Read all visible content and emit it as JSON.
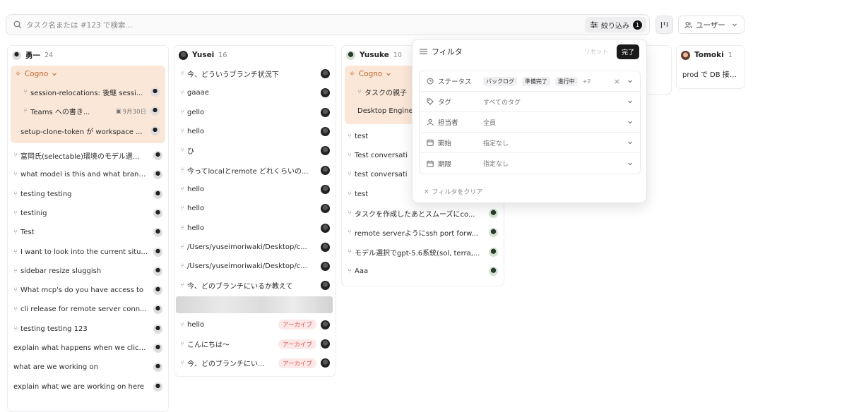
{
  "search": {
    "placeholder": "タスク名または #123 で検索..."
  },
  "toolbar": {
    "filter_label": "絞り込み",
    "filter_count": "1",
    "user_label": "ユーザー"
  },
  "columns": [
    {
      "name": "勇一",
      "count": "24",
      "group": {
        "label": "Cogno",
        "items": [
          {
            "text": "session-relocations: 後継 sessi..."
          },
          {
            "text": "Teams への書き...",
            "date": "9月30日"
          },
          {
            "text": "setup-clone-token が workspace ..."
          }
        ]
      },
      "items": [
        "富岡氏(selectable)環境のモデル選...",
        "what model is this and what branc...",
        "testing testing",
        "testinig",
        "Test",
        "I want to look into the current situ...",
        "sidebar resize sluggish",
        "What mcp's do you have access to",
        "cli release for remote server conn...",
        "testing testing 123",
        "explain what happens when we click ...",
        "what are we working on",
        "explain what we are working on here"
      ]
    },
    {
      "name": "Yusei",
      "count": "16",
      "items": [
        "今、どういうブランチ状況下",
        "gaaae",
        "gello",
        "hello",
        "ひ",
        "今ってlocalとremote どれくらいの...",
        "hello",
        "hello",
        "hello",
        "/Users/yuseimoriwaki/Desktop/c...",
        "/Users/yuseimoriwaki/Desktop/c...",
        "今、どのブランチにいるか教えて"
      ],
      "archived_items": [
        "hello",
        "こんにちは〜",
        "今、どのブランチにい..."
      ],
      "archive_label": "アーカイブ"
    },
    {
      "name": "Yusuke",
      "count": "10",
      "group": {
        "label": "Cogno",
        "items": [
          {
            "text": "タスクの親子"
          },
          {
            "text": "Desktop Engine"
          }
        ]
      },
      "items": [
        "test",
        "Test conversati",
        "test conversati",
        "test",
        "タスクを作成したあとスムーズにco...",
        "remote serverようにssh port forw...",
        "モデル選択でgpt-5.6系統(sol, terra,...",
        "Aaa"
      ]
    },
    {
      "name": "Tomoki",
      "count": "1",
      "items": [
        "prod で DB 接続枯"
      ]
    }
  ],
  "filter_panel": {
    "title": "フィルタ",
    "reset_label": "リセット",
    "done_label": "完了",
    "rows": [
      {
        "label": "ステータス",
        "chips": [
          "バックログ",
          "準備完了",
          "進行中"
        ],
        "more": "+2"
      },
      {
        "label": "タグ",
        "value": "すべてのタグ"
      },
      {
        "label": "担当者",
        "value": "全員"
      },
      {
        "label": "開始",
        "value": "指定なし"
      },
      {
        "label": "期限",
        "value": "指定なし"
      }
    ],
    "clear_label": "フィルタをクリア"
  }
}
